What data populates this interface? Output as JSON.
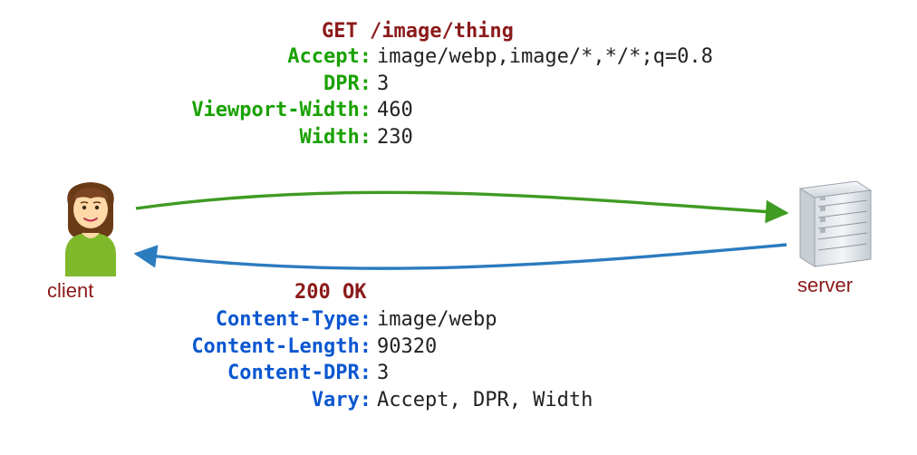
{
  "request": {
    "line": "GET /image/thing",
    "headers": [
      {
        "key": "Accept:",
        "value": "image/webp,image/*,*/*;q=0.8"
      },
      {
        "key": "DPR:",
        "value": "3"
      },
      {
        "key": "Viewport-Width:",
        "value": "460"
      },
      {
        "key": "Width:",
        "value": "230"
      }
    ]
  },
  "response": {
    "status": "200 OK",
    "headers": [
      {
        "key": "Content-Type:",
        "value": "image/webp"
      },
      {
        "key": "Content-Length:",
        "value": "90320"
      },
      {
        "key": "Content-DPR:",
        "value": "3"
      },
      {
        "key": "Vary:",
        "value": "Accept, DPR, Width"
      }
    ]
  },
  "labels": {
    "client": "client",
    "server": "server"
  }
}
